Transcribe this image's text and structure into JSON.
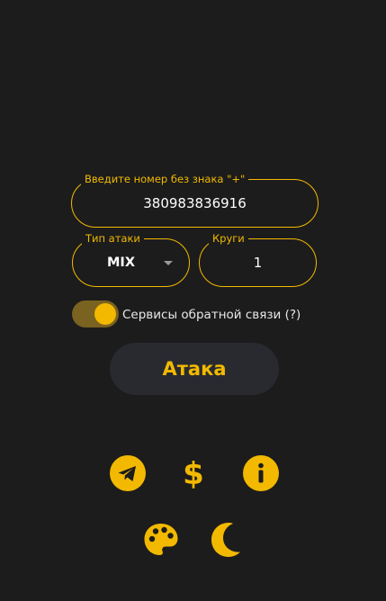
{
  "phone_field": {
    "label": "Введите номер без знака \"+\"",
    "value": "380983836916"
  },
  "attack_type": {
    "label": "Тип атаки",
    "value": "MIX"
  },
  "rounds": {
    "label": "Круги",
    "value": "1"
  },
  "feedback_toggle": {
    "label": "Сервисы обратной связи (?)",
    "enabled": true
  },
  "attack_button": {
    "label": "Атака"
  },
  "icons": [
    "telegram-icon",
    "dollar-icon",
    "info-icon",
    "palette-icon",
    "moon-icon"
  ],
  "colors": {
    "accent": "#f2b900",
    "background": "#1c1c1c",
    "button_bg": "#282a30",
    "toggle_track": "#7a6220"
  }
}
